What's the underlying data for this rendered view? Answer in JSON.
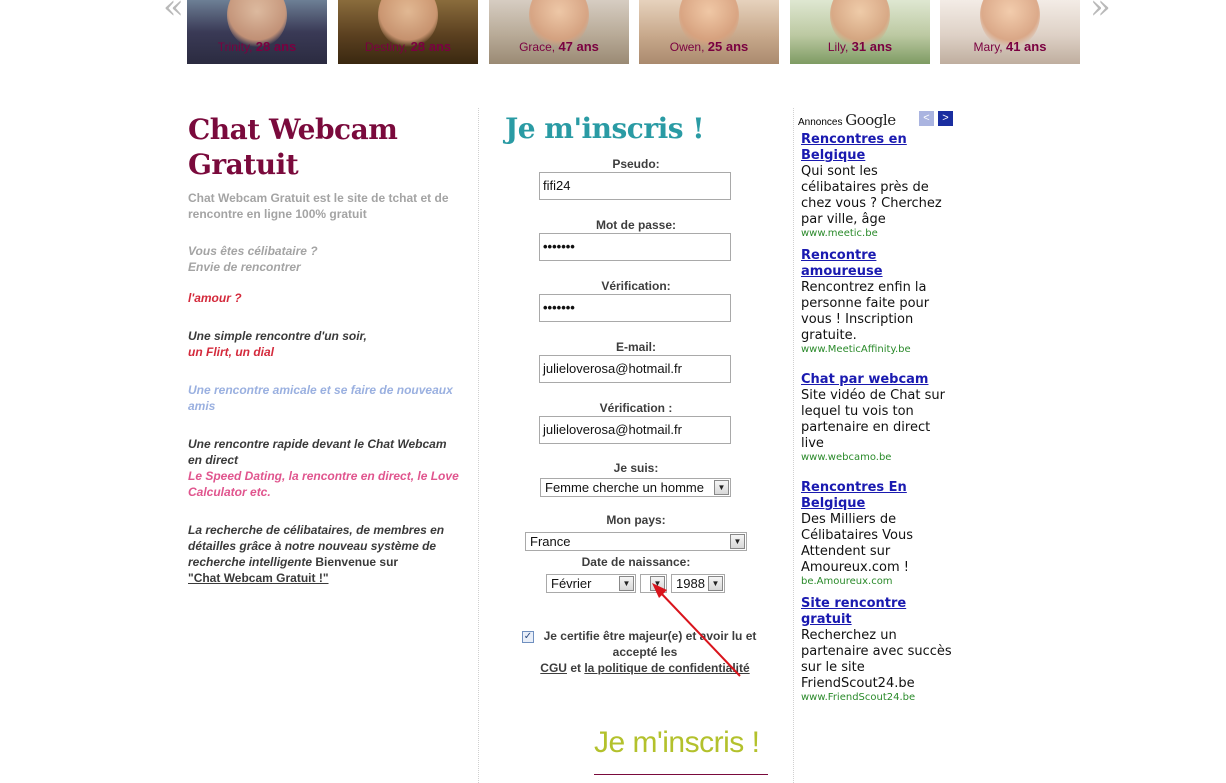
{
  "strip": {
    "prev_arrow": "«",
    "next_arrow": "»",
    "profiles": [
      {
        "name": "Trinity,",
        "age": "28 ans"
      },
      {
        "name": "Destiny,",
        "age": "28 ans"
      },
      {
        "name": "Grace,",
        "age": "47 ans"
      },
      {
        "name": "Owen,",
        "age": "25 ans"
      },
      {
        "name": "Lily,",
        "age": "31 ans"
      },
      {
        "name": "Mary,",
        "age": "41 ans"
      }
    ]
  },
  "left": {
    "title": "Chat Webcam Gratuit",
    "intro": "Chat Webcam Gratuit est le site de tchat et de rencontre en ligne 100% gratuit",
    "q1_line1": "Vous êtes célibataire ?",
    "q1_line2": "Envie de rencontrer",
    "amour": "l'amour ?",
    "simple": "Une simple rencontre d'un soir,",
    "flirt": "un Flirt, un dial",
    "amicale": "Une rencontre amicale et se faire de nouveaux amis",
    "rapide": "Une rencontre rapide devant le Chat Webcam en direct",
    "speed": "Le Speed Dating, la rencontre en direct, le Love Calculator etc.",
    "recherche": "La recherche de célibataires, de membres en détailles grâce à notre nouveau système de recherche intelligente",
    "bienvenue": "Bienvenue sur",
    "link": "\"Chat Webcam Gratuit !\""
  },
  "form": {
    "title": "Je m'inscris !",
    "pseudo_label": "Pseudo:",
    "pseudo_value": "fifi24",
    "password_label": "Mot de passe:",
    "password_value": "•••••••",
    "verif_label": "Vérification:",
    "verif_value": "•••••••",
    "email_label": "E-mail:",
    "email_value": "julieloverosa@hotmail.fr",
    "email_verif_label": "Vérification :",
    "email_verif_value": "julieloverosa@hotmail.fr",
    "je_suis_label": "Je suis:",
    "je_suis_value": "Femme cherche un homme",
    "pays_label": "Mon pays:",
    "pays_value": "France",
    "naissance_label": "Date de naissance:",
    "month_value": "Février",
    "day_value": "",
    "year_value": "1988",
    "checkbox_mark": "✓",
    "cert_text": "Je certifie être majeur(e) et avoir lu et accepté les",
    "cgu": "CGU",
    "et": "et",
    "privacy": "la politique de confidentialité",
    "submit": "Je m'inscris !"
  },
  "ads": {
    "label": "Annonces",
    "google": "Google",
    "prev": "<",
    "next": ">",
    "items": [
      {
        "title": "Rencontres en Belgique",
        "desc": "Qui sont les célibataires près de chez vous ? Cherchez par ville, âge",
        "url": "www.meetic.be"
      },
      {
        "title": "Rencontre amoureuse",
        "desc": "Rencontrez enfin la personne faite pour vous ! Inscription gratuite.",
        "url": "www.MeeticAffinity.be"
      },
      {
        "title": "Chat par webcam",
        "desc": "Site vidéo de Chat sur lequel tu vois ton partenaire en direct live",
        "url": "www.webcamo.be"
      },
      {
        "title": "Rencontres En Belgique",
        "desc": "Des Milliers de Célibataires Vous Attendent sur Amoureux.com !",
        "url": "be.Amoureux.com"
      },
      {
        "title": "Site rencontre gratuit",
        "desc": "Recherchez un partenaire avec succès sur le site FriendScout24.be",
        "url": "www.FriendScout24.be"
      }
    ]
  },
  "colors": {
    "brand": "#7a0a3c",
    "form_title": "#2a9ba4",
    "submit": "#b3c12c",
    "annotation_arrow": "#d9141c"
  }
}
